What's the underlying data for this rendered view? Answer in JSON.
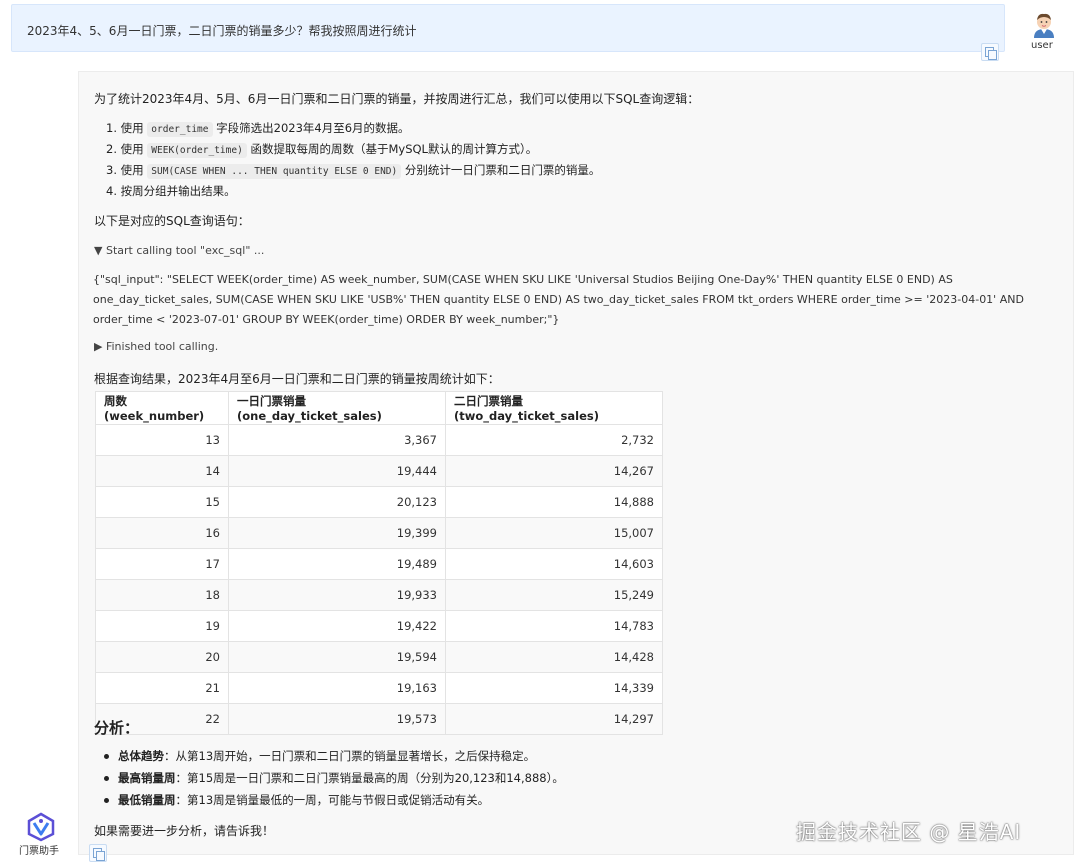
{
  "user_message": {
    "text": "2023年4、5、6月一日门票，二日门票的销量多少？帮我按照周进行统计",
    "sender_label": "user"
  },
  "assistant": {
    "label": "门票助手",
    "intro": "为了统计2023年4月、5月、6月一日门票和二日门票的销量，并按周进行汇总，我们可以使用以下SQL查询逻辑：",
    "steps": [
      {
        "num": "1.",
        "pre": "使用",
        "code": "order_time",
        "post": "字段筛选出2023年4月至6月的数据。"
      },
      {
        "num": "2.",
        "pre": "使用",
        "code": "WEEK(order_time)",
        "post": "函数提取每周的周数（基于MySQL默认的周计算方式）。"
      },
      {
        "num": "3.",
        "pre": "使用",
        "code": "SUM(CASE WHEN ... THEN quantity ELSE 0 END)",
        "post": "分别统计一日门票和二日门票的销量。"
      },
      {
        "num": "4.",
        "pre": "按周分组并输出结果。",
        "code": "",
        "post": ""
      }
    ],
    "sql_intro": "以下是对应的SQL查询语句：",
    "tool_start": "▼ Start calling tool \"exc_sql\" ...",
    "tool_input": "{\"sql_input\": \"SELECT WEEK(order_time) AS week_number, SUM(CASE WHEN SKU LIKE 'Universal Studios Beijing One-Day%' THEN quantity ELSE 0 END) AS one_day_ticket_sales, SUM(CASE WHEN SKU LIKE 'USB%' THEN quantity ELSE 0 END) AS two_day_ticket_sales FROM tkt_orders WHERE order_time >= '2023-04-01' AND order_time < '2023-07-01' GROUP BY WEEK(order_time) ORDER BY week_number;\"}",
    "tool_end": "▶ Finished tool calling.",
    "result_intro": "根据查询结果，2023年4月至6月一日门票和二日门票的销量按周统计如下：",
    "table": {
      "headers": [
        "周数 (week_number)",
        "一日门票销量 (one_day_ticket_sales)",
        "二日门票销量 (two_day_ticket_sales)"
      ],
      "rows": [
        [
          "13",
          "3,367",
          "2,732"
        ],
        [
          "14",
          "19,444",
          "14,267"
        ],
        [
          "15",
          "20,123",
          "14,888"
        ],
        [
          "16",
          "19,399",
          "15,007"
        ],
        [
          "17",
          "19,489",
          "14,603"
        ],
        [
          "18",
          "19,933",
          "15,249"
        ],
        [
          "19",
          "19,422",
          "14,783"
        ],
        [
          "20",
          "19,594",
          "14,428"
        ],
        [
          "21",
          "19,163",
          "14,339"
        ],
        [
          "22",
          "19,573",
          "14,297"
        ]
      ]
    },
    "analysis_title": "分析：",
    "analysis": [
      {
        "label": "总体趋势",
        "text": "：从第13周开始，一日门票和二日门票的销量显著增长，之后保持稳定。"
      },
      {
        "label": "最高销量周",
        "text": "：第15周是一日门票和二日门票销量最高的周（分别为20,123和14,888）。"
      },
      {
        "label": "最低销量周",
        "text": "：第13周是销量最低的一周，可能与节假日或促销活动有关。"
      }
    ],
    "closing": "如果需要进一步分析，请告诉我！"
  },
  "watermark": "掘金技术社区 @ 星浩AI",
  "icons": {
    "user_avatar": "user-avatar-icon",
    "assistant_avatar": "assistant-logo-icon",
    "copy": "copy-icon"
  }
}
